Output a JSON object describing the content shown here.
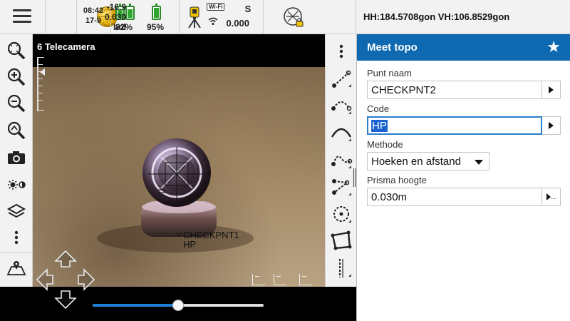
{
  "status": {
    "time": "08:42",
    "date": "17-9",
    "battery1_pct": "82%",
    "battery2_pct": "95%",
    "battery1_level": 0.82,
    "battery2_level": 0.95,
    "wifi_badge": "Wi-Fi",
    "stat_letter": "S",
    "stat_value": "0.000",
    "target_value1": "-16.9",
    "target_value2": "0.030",
    "target_value3": "bol",
    "angles": "HH:184.5708gon  VH:106.8529gon"
  },
  "camera": {
    "title": "6 Telecamera",
    "point_name": "CHECKPNT1",
    "point_code": "HP",
    "zoom_level": 0.5
  },
  "panel": {
    "title": "Meet topo",
    "point_name_label": "Punt naam",
    "point_name_value": "CHECKPNT2",
    "code_label": "Code",
    "code_value": "HP",
    "method_label": "Methode",
    "method_value": "Hoeken en afstand",
    "prism_label": "Prisma hoogte",
    "prism_value": "0.030m",
    "prism_button": "..."
  },
  "colors": {
    "header_blue": "#0e69b0",
    "slider_blue": "#1e7fd6",
    "battery_green": "#2fa52f"
  },
  "icons": {
    "left_toolbar": [
      "zoom-extents-icon",
      "zoom-in-icon",
      "zoom-out-icon",
      "zoom-previous-icon",
      "camera-icon",
      "brightness-icon",
      "layers-icon",
      "more-vert-icon",
      "map-icon"
    ],
    "right_toolbar": [
      "more-vert-icon",
      "line-tool-icon",
      "arc-tool-icon",
      "curve-tool-icon",
      "spline-tool-icon",
      "polyline-tool-icon",
      "circle-tool-icon",
      "polygon-tool-icon",
      "vertical-line-tool-icon"
    ]
  }
}
